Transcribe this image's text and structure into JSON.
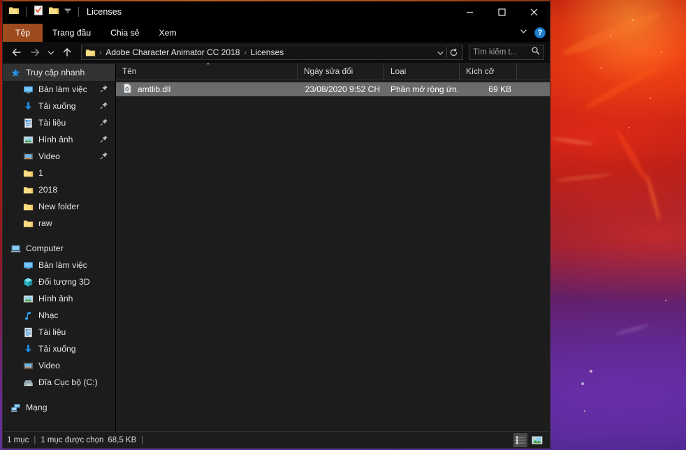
{
  "window": {
    "title": "Licenses",
    "quick_access_toolbar": [
      {
        "name": "folder-icon",
        "label": "Folder"
      },
      {
        "name": "properties-icon",
        "label": "Properties"
      },
      {
        "name": "new-folder-icon",
        "label": "New folder"
      },
      {
        "name": "chevron-down-icon",
        "label": "Customize Quick Access Toolbar"
      }
    ],
    "controls": {
      "minimize": "–",
      "maximize": "□",
      "close": "✕"
    }
  },
  "ribbon": {
    "tabs": [
      {
        "label": "Tệp",
        "active": true
      },
      {
        "label": "Trang đầu",
        "active": false
      },
      {
        "label": "Chia sẻ",
        "active": false
      },
      {
        "label": "Xem",
        "active": false
      }
    ],
    "collapse_label": "∨",
    "help_label": "?"
  },
  "address": {
    "back_label": "←",
    "forward_label": "→",
    "recent_label": "∨",
    "up_label": "↑",
    "breadcrumbs": [
      "Adobe Character Animator CC 2018",
      "Licenses"
    ],
    "separator": "›",
    "dropdown_label": "∨",
    "refresh_label": "↻"
  },
  "search": {
    "placeholder": "Tìm kiếm t...",
    "value": ""
  },
  "navpane": {
    "quick_access": {
      "label": "Truy cập nhanh",
      "icon": "star-icon",
      "selected": true,
      "items": [
        {
          "label": "Bàn làm việc",
          "icon": "desktop-icon",
          "pinned": true
        },
        {
          "label": "Tải xuống",
          "icon": "downloads-icon",
          "pinned": true
        },
        {
          "label": "Tài liệu",
          "icon": "documents-icon",
          "pinned": true
        },
        {
          "label": "Hình ảnh",
          "icon": "pictures-icon",
          "pinned": true
        },
        {
          "label": "Video",
          "icon": "videos-icon",
          "pinned": true
        },
        {
          "label": "1",
          "icon": "folder-icon",
          "pinned": false
        },
        {
          "label": "2018",
          "icon": "folder-icon",
          "pinned": false
        },
        {
          "label": "New folder",
          "icon": "folder-icon",
          "pinned": false
        },
        {
          "label": "raw",
          "icon": "folder-icon",
          "pinned": false
        }
      ]
    },
    "computer": {
      "label": "Computer",
      "icon": "computer-icon",
      "items": [
        {
          "label": "Bàn làm việc",
          "icon": "desktop-icon"
        },
        {
          "label": "Đối tượng 3D",
          "icon": "3d-objects-icon"
        },
        {
          "label": "Hình ảnh",
          "icon": "pictures-icon"
        },
        {
          "label": "Nhạc",
          "icon": "music-icon"
        },
        {
          "label": "Tài liệu",
          "icon": "documents-icon"
        },
        {
          "label": "Tải xuống",
          "icon": "downloads-icon"
        },
        {
          "label": "Video",
          "icon": "videos-icon"
        },
        {
          "label": "Đĩa Cục bộ (C:)",
          "icon": "local-disk-icon"
        }
      ]
    },
    "network": {
      "label": "Mạng",
      "icon": "network-icon"
    }
  },
  "filelist": {
    "columns": [
      {
        "key": "name",
        "label": "Tên",
        "sorted": "asc"
      },
      {
        "key": "date",
        "label": "Ngày sửa đổi"
      },
      {
        "key": "type",
        "label": "Loại"
      },
      {
        "key": "size",
        "label": "Kích cỡ"
      }
    ],
    "sort_caret": "⌃",
    "rows": [
      {
        "name": "amtlib.dll",
        "date": "23/08/2020 9:52 CH",
        "type": "Phần mở rộng ứn...",
        "size": "69 KB",
        "icon": "dll-file-icon",
        "selected": true
      }
    ]
  },
  "statusbar": {
    "item_count": "1 mục",
    "separator": "|",
    "selection": "1 mục được chọn",
    "selection_size": "68,5 KB",
    "trailing_separator": "|",
    "views": [
      {
        "name": "details-view-button",
        "label": "Details",
        "active": true
      },
      {
        "name": "large-icons-view-button",
        "label": "Large icons",
        "active": false
      }
    ]
  },
  "colors": {
    "file_tab": "#9d4a1e",
    "selection": "#6b6b6b",
    "accent_blue": "#1e7fd4",
    "nav_background": "#1c1c1c"
  }
}
